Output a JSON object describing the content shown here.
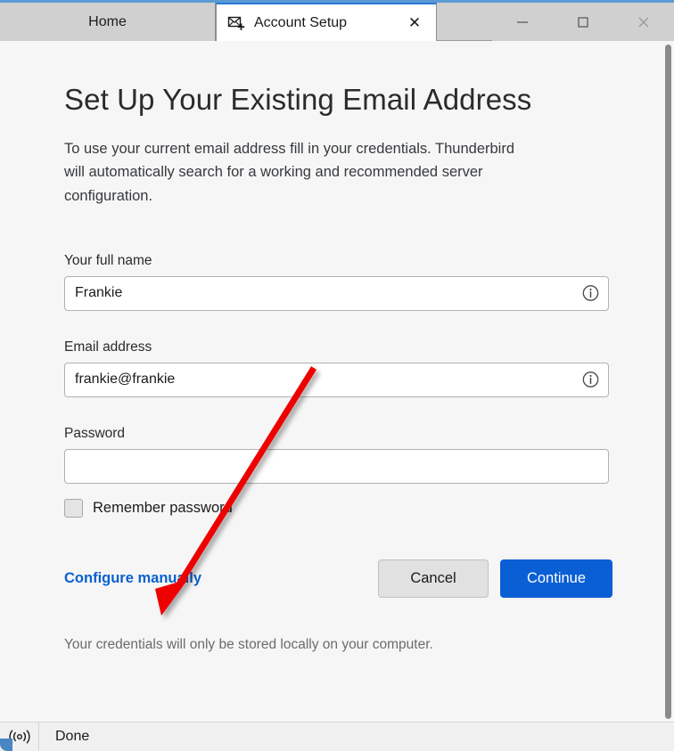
{
  "window": {
    "controls": {
      "minimize_label": "Minimize",
      "maximize_label": "Maximize",
      "close_label": "Close"
    },
    "accent_border_color": "#5b9bd5"
  },
  "tabs": [
    {
      "label": "Home",
      "icon": "",
      "active": false,
      "closable": false
    },
    {
      "label": "Account Setup",
      "icon": "mail-plus-icon",
      "active": true,
      "closable": true,
      "close_glyph": "✕"
    }
  ],
  "page": {
    "title": "Set Up Your Existing Email Address",
    "subtitle": "To use your current email address fill in your credentials. Thunderbird will automatically search for a working and recommended server configuration.",
    "footnote": "Your credentials will only be stored locally on your computer."
  },
  "form": {
    "full_name": {
      "label": "Your full name",
      "value": "Frankie",
      "placeholder": "",
      "info_icon": "info-circle-icon"
    },
    "email": {
      "label": "Email address",
      "value": "frankie@frankie",
      "placeholder": "",
      "info_icon": "info-circle-icon"
    },
    "password": {
      "label": "Password",
      "value": "",
      "placeholder": ""
    },
    "remember_password": {
      "label": "Remember password",
      "checked": false
    }
  },
  "actions": {
    "configure_manually": "Configure manually",
    "cancel": "Cancel",
    "continue": "Continue",
    "primary_color": "#0a5fd4",
    "link_color": "#0a60cf"
  },
  "statusbar": {
    "icon": "broadcast-signal-icon",
    "text": "Done"
  },
  "annotation": {
    "arrow_color": "#ee0000",
    "points_at": "Configure manually"
  }
}
